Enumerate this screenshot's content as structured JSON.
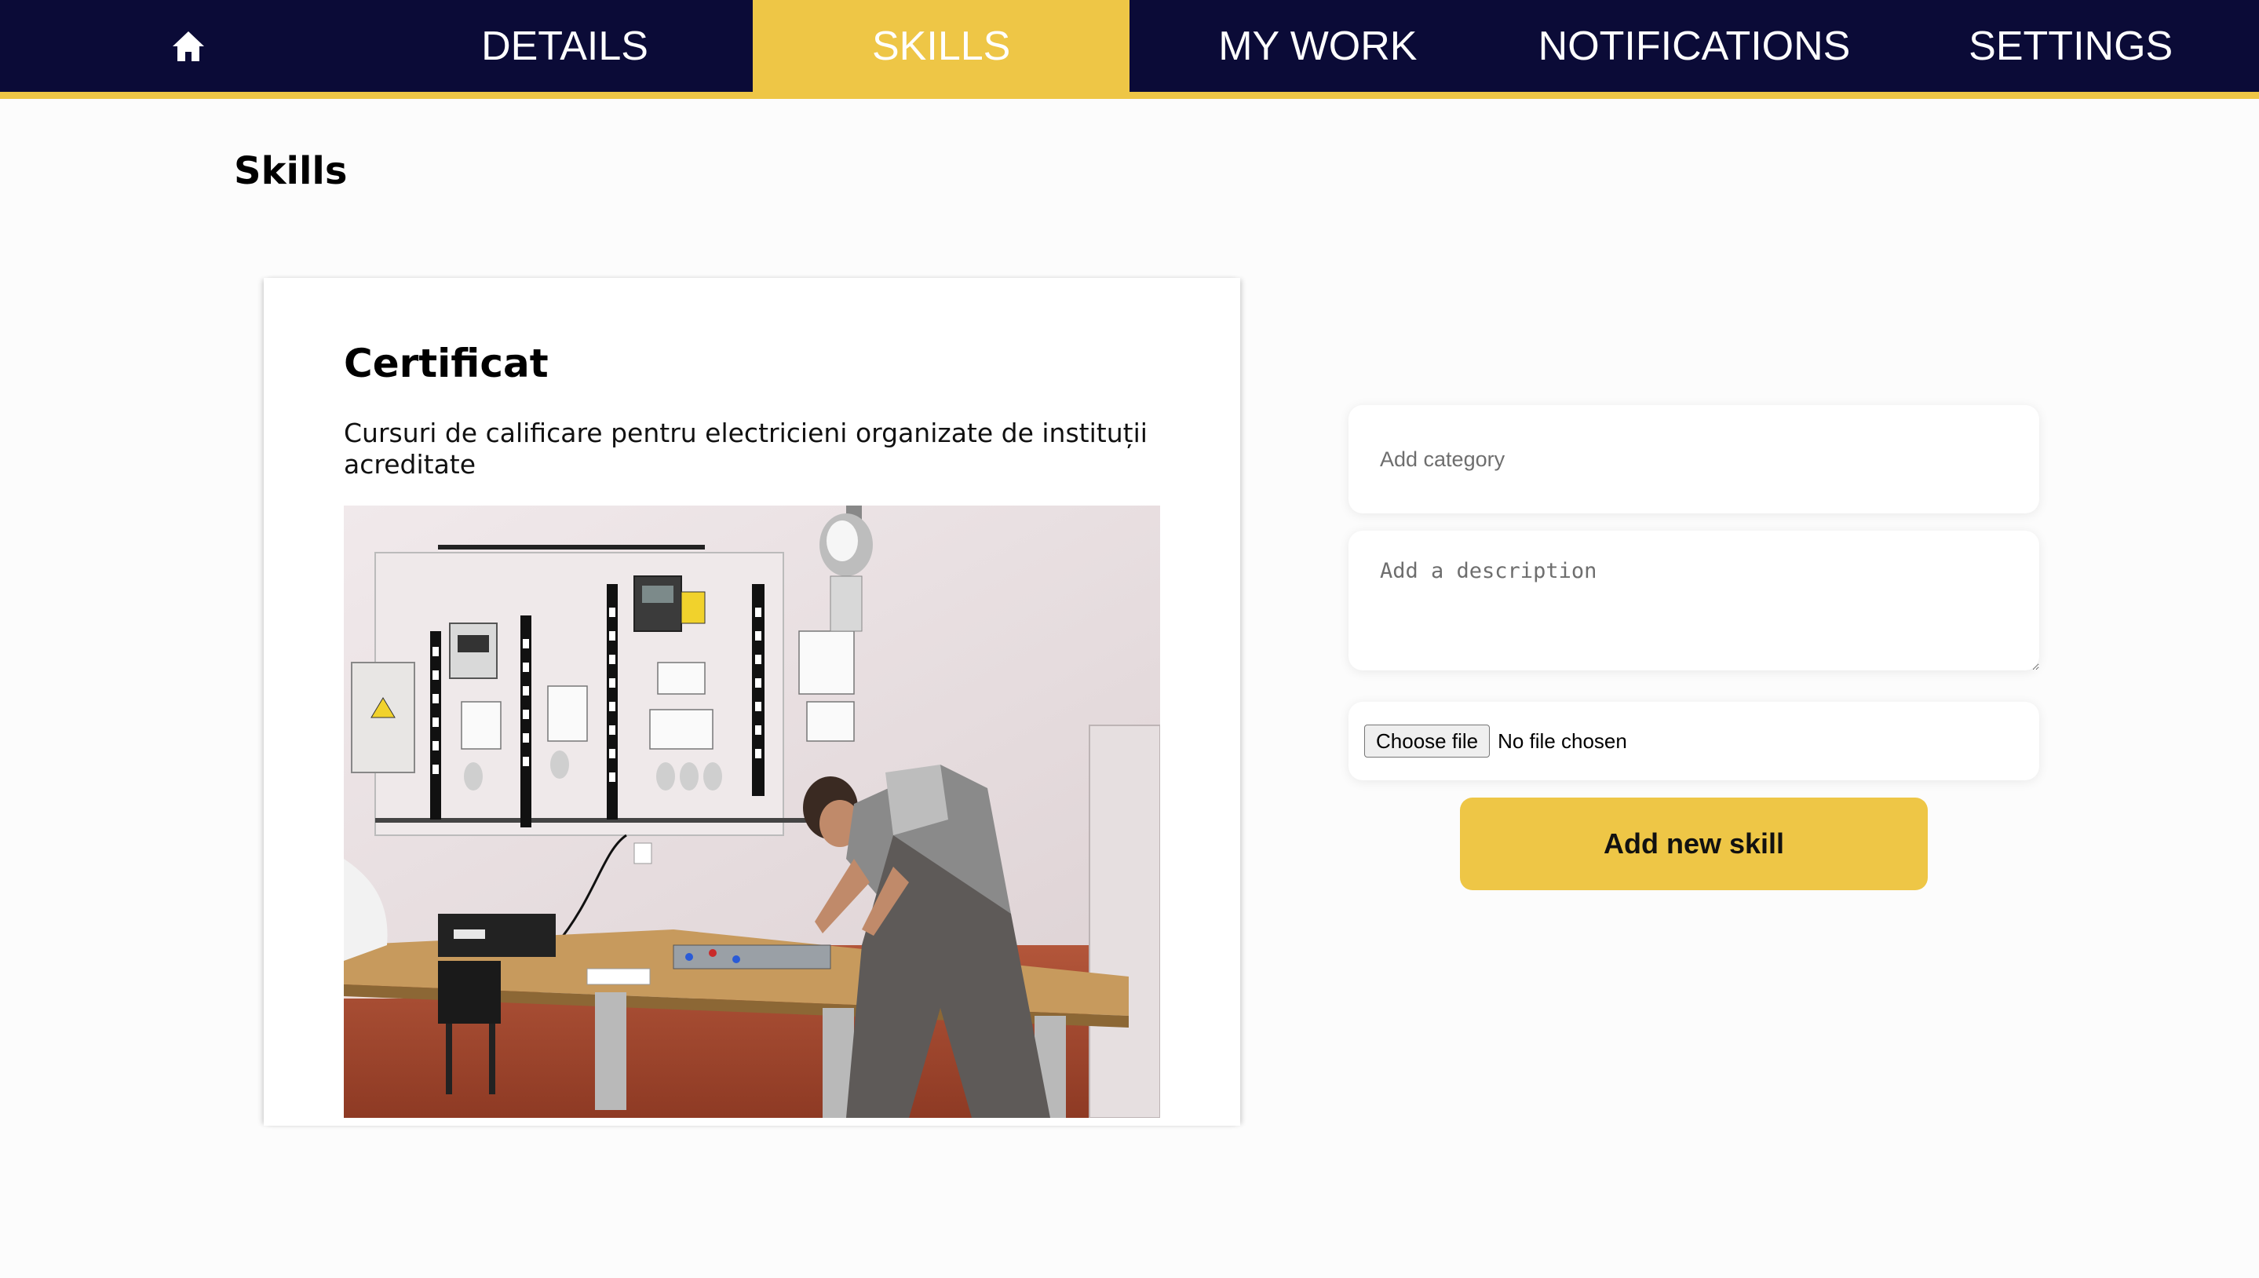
{
  "nav": {
    "home_icon": "home-icon",
    "items": [
      {
        "label": "DETAILS",
        "active": false
      },
      {
        "label": "SKILLS",
        "active": true
      },
      {
        "label": "MY WORK",
        "active": false
      },
      {
        "label": "NOTIFICATIONS",
        "active": false
      },
      {
        "label": "SETTINGS",
        "active": false
      }
    ]
  },
  "page": {
    "title": "Skills"
  },
  "skill_card": {
    "title": "Certificat",
    "description": "Cursuri de calificare pentru electricieni organizate de instituții acreditate",
    "photo": "electrician-training-photo"
  },
  "form": {
    "category_placeholder": "Add category",
    "description_placeholder": "Add a description",
    "file_button_label": "Choose file",
    "file_status": "No file chosen",
    "submit_label": "Add new skill"
  },
  "colors": {
    "navbar_bg": "#0b0b37",
    "accent": "#eec646",
    "page_bg": "#fcfcfc"
  }
}
